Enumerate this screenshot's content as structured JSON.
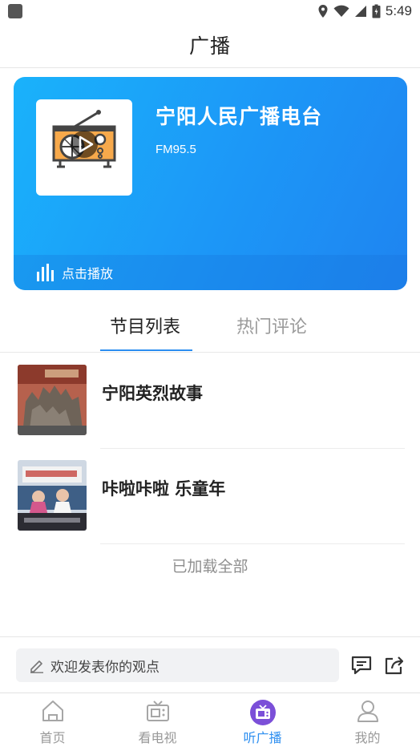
{
  "status_bar": {
    "time": "5:49"
  },
  "header": {
    "title": "广播"
  },
  "station": {
    "name": "宁阳人民广播电台",
    "frequency": "FM95.5",
    "play_label": "点击播放",
    "card_colors": [
      "#1ab2fb",
      "#1f84f0"
    ]
  },
  "tabs": [
    {
      "label": "节目列表",
      "active": true
    },
    {
      "label": "热门评论",
      "active": false
    }
  ],
  "programs": [
    {
      "title": "宁阳英烈故事"
    },
    {
      "title": "咔啦咔啦 乐童年"
    }
  ],
  "list_end_text": "已加载全部",
  "comment": {
    "placeholder": "欢迎发表你的观点"
  },
  "bottom_nav": [
    {
      "label": "首页",
      "icon": "home-icon",
      "active": false
    },
    {
      "label": "看电视",
      "icon": "tv-icon",
      "active": false
    },
    {
      "label": "听广播",
      "icon": "radio-icon",
      "active": true
    },
    {
      "label": "我的",
      "icon": "user-icon",
      "active": false
    }
  ],
  "accent_color": "#2c8ef0"
}
